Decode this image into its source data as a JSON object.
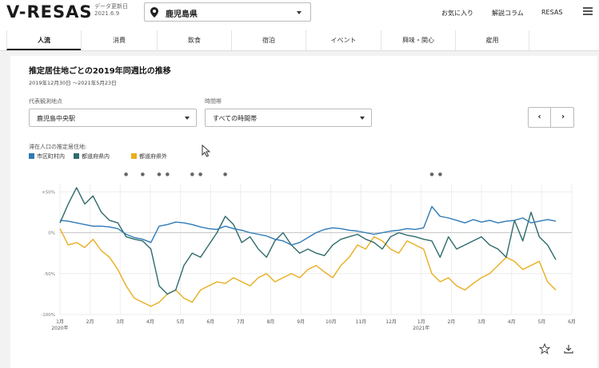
{
  "header": {
    "logo": "V-RESAS",
    "update_label": "データ更新日",
    "update_date": "2021.6.9",
    "prefecture": "鹿児島県",
    "nav": [
      "お気に入り",
      "解説コラム",
      "RESAS"
    ]
  },
  "tabs": [
    "人流",
    "消費",
    "飲食",
    "宿泊",
    "イベント",
    "興味・関心",
    "雇用"
  ],
  "active_tab": 0,
  "chart_section": {
    "title": "推定居住地ごとの2019年同週比の推移",
    "period": "2019年12月30日 〜2021年5月23日",
    "location_label": "代表観測地点",
    "location_value": "鹿児島中央駅",
    "time_label": "時間帯",
    "time_value": "すべての時間帯",
    "prev_glyph": "‹",
    "next_glyph": "›",
    "legend_title": "滞在人口の推定居住地:"
  },
  "chart_data": {
    "type": "line",
    "ylim": [
      -100,
      60
    ],
    "y_ticks": [
      {
        "value": 50,
        "label": "+50%"
      },
      {
        "value": 0,
        "label": "0%"
      },
      {
        "value": -50,
        "label": "-50%"
      },
      {
        "value": -100,
        "label": "-100%"
      }
    ],
    "x_ticks": [
      "1月",
      "2月",
      "3月",
      "4月",
      "5月",
      "6月",
      "7月",
      "8月",
      "9月",
      "10月",
      "11月",
      "12月",
      "1月",
      "2月",
      "3月",
      "4月",
      "5月",
      "6月"
    ],
    "year_labels": [
      {
        "index": 0,
        "label": "2020年"
      },
      {
        "index": 12,
        "label": "2021年"
      }
    ],
    "markers": [
      "●",
      "●",
      "●",
      "●",
      "●",
      "●",
      "●",
      "●",
      "●"
    ],
    "grid": true,
    "legend_position": "top-left",
    "series": [
      {
        "name": "市区町村内",
        "color": "#2e7ab7",
        "values": [
          15,
          14,
          12,
          10,
          8,
          8,
          7,
          5,
          -2,
          -6,
          -8,
          -12,
          8,
          10,
          13,
          12,
          10,
          7,
          5,
          4,
          8,
          5,
          3,
          0,
          -2,
          -4,
          -8,
          -10,
          -15,
          -12,
          -6,
          0,
          4,
          6,
          5,
          3,
          2,
          0,
          -2,
          0,
          2,
          3,
          5,
          4,
          6,
          32,
          20,
          18,
          15,
          12,
          16,
          13,
          15,
          12,
          14,
          15,
          18,
          12,
          14,
          16,
          14
        ]
      },
      {
        "name": "都道府県内",
        "color": "#2e6b6a",
        "values": [
          12,
          35,
          55,
          35,
          45,
          25,
          15,
          12,
          -5,
          -8,
          -10,
          -20,
          -65,
          -75,
          -70,
          -40,
          -25,
          -30,
          -15,
          0,
          20,
          10,
          -12,
          -5,
          -20,
          -30,
          -10,
          0,
          -15,
          -25,
          -20,
          -25,
          -28,
          -15,
          -8,
          -5,
          -2,
          -8,
          -12,
          -20,
          -5,
          0,
          -3,
          -5,
          -8,
          -10,
          -30,
          -5,
          -20,
          -15,
          -10,
          -5,
          -15,
          -20,
          -30,
          15,
          -10,
          25,
          -5,
          -15,
          -33
        ]
      },
      {
        "name": "都道府県外",
        "color": "#e8ae1e",
        "values": [
          5,
          -15,
          -12,
          -18,
          -8,
          -22,
          -30,
          -45,
          -65,
          -80,
          -85,
          -90,
          -85,
          -75,
          -70,
          -80,
          -85,
          -70,
          -65,
          -60,
          -62,
          -55,
          -60,
          -65,
          -55,
          -50,
          -60,
          -55,
          -50,
          -55,
          -45,
          -40,
          -48,
          -55,
          -40,
          -30,
          -15,
          -20,
          -5,
          -10,
          -20,
          -25,
          -10,
          -15,
          -20,
          -50,
          -60,
          -55,
          -65,
          -70,
          -62,
          -55,
          -50,
          -40,
          -30,
          -35,
          -45,
          -40,
          -35,
          -60,
          -70
        ]
      }
    ]
  }
}
